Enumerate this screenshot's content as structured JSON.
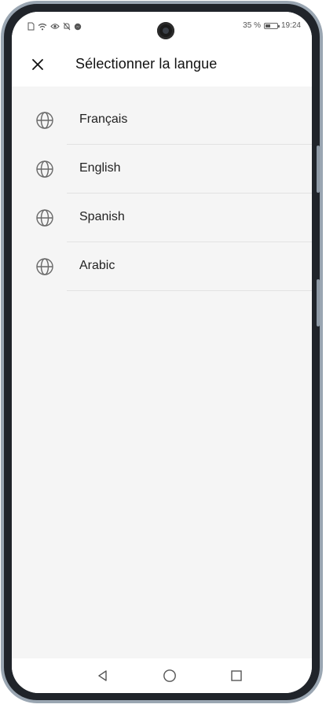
{
  "status_bar": {
    "battery": "35 %",
    "time": "19:24",
    "icons": [
      "sim-icon",
      "wifi-icon",
      "eye-icon",
      "mute-icon",
      "messenger-icon"
    ]
  },
  "header": {
    "close_icon": "close-icon",
    "title": "Sélectionner la langue"
  },
  "languages": [
    {
      "label": "Français",
      "icon": "globe-icon"
    },
    {
      "label": "English",
      "icon": "globe-icon"
    },
    {
      "label": "Spanish",
      "icon": "globe-icon"
    },
    {
      "label": "Arabic",
      "icon": "globe-icon"
    }
  ],
  "navigation": {
    "back_icon": "back-icon",
    "home_icon": "home-icon",
    "recents_icon": "recents-icon"
  },
  "colors": {
    "background": "#f5f5f5",
    "surface": "#ffffff",
    "text": "#222222",
    "divider": "#e2e2e2",
    "frame": "#9aa6b2"
  }
}
